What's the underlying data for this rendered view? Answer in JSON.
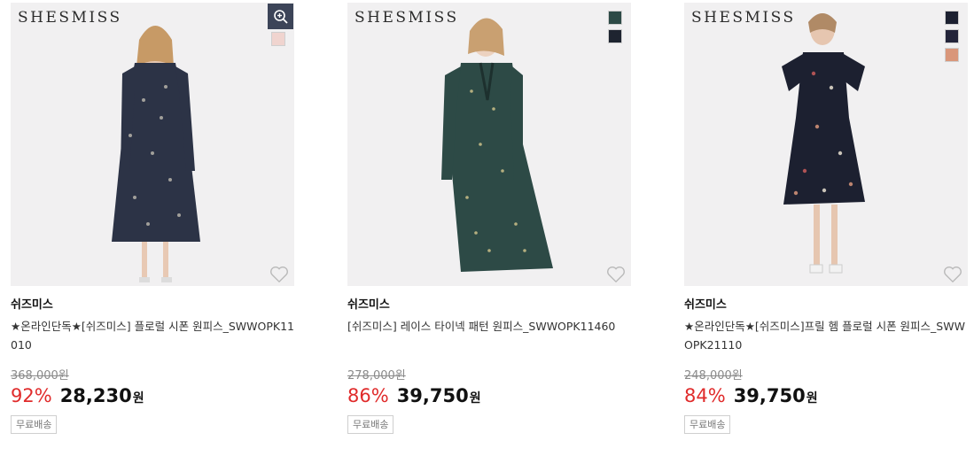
{
  "colors": {
    "accent_discount": "#e02b2b",
    "zoom_button_bg": "#3c4458",
    "image_bg": "#f1f0f1"
  },
  "products": [
    {
      "logo": "SHESMISS",
      "brand": "쉬즈미스",
      "title": "★온라인단독★[쉬즈미스] 플로럴 시폰 원피스_SWWOPK11010",
      "original_price": "368,000원",
      "discount": "92%",
      "sale_price": "28,230",
      "currency": "원",
      "badge": "무료배송",
      "swatches": [
        "#f0d4cf"
      ],
      "icons": [
        "zoom-in-icon",
        "heart-icon"
      ]
    },
    {
      "logo": "SHESMISS",
      "brand": "쉬즈미스",
      "title": "[쉬즈미스] 레이스 타이넥 패턴 원피스_SWWOPK11460",
      "original_price": "278,000원",
      "discount": "86%",
      "sale_price": "39,750",
      "currency": "원",
      "badge": "무료배송",
      "swatches": [
        "#2d4a46",
        "#1e2430"
      ],
      "icons": [
        "heart-icon"
      ]
    },
    {
      "logo": "SHESMISS",
      "brand": "쉬즈미스",
      "title": "★온라인단독★[쉬즈미스]프릴 헴 플로럴 시폰 원피스_SWWOPK21110",
      "original_price": "248,000원",
      "discount": "84%",
      "sale_price": "39,750",
      "currency": "원",
      "badge": "무료배송",
      "swatches": [
        "#1c2030",
        "#23243a",
        "#d9967a"
      ],
      "icons": [
        "heart-icon"
      ]
    }
  ]
}
